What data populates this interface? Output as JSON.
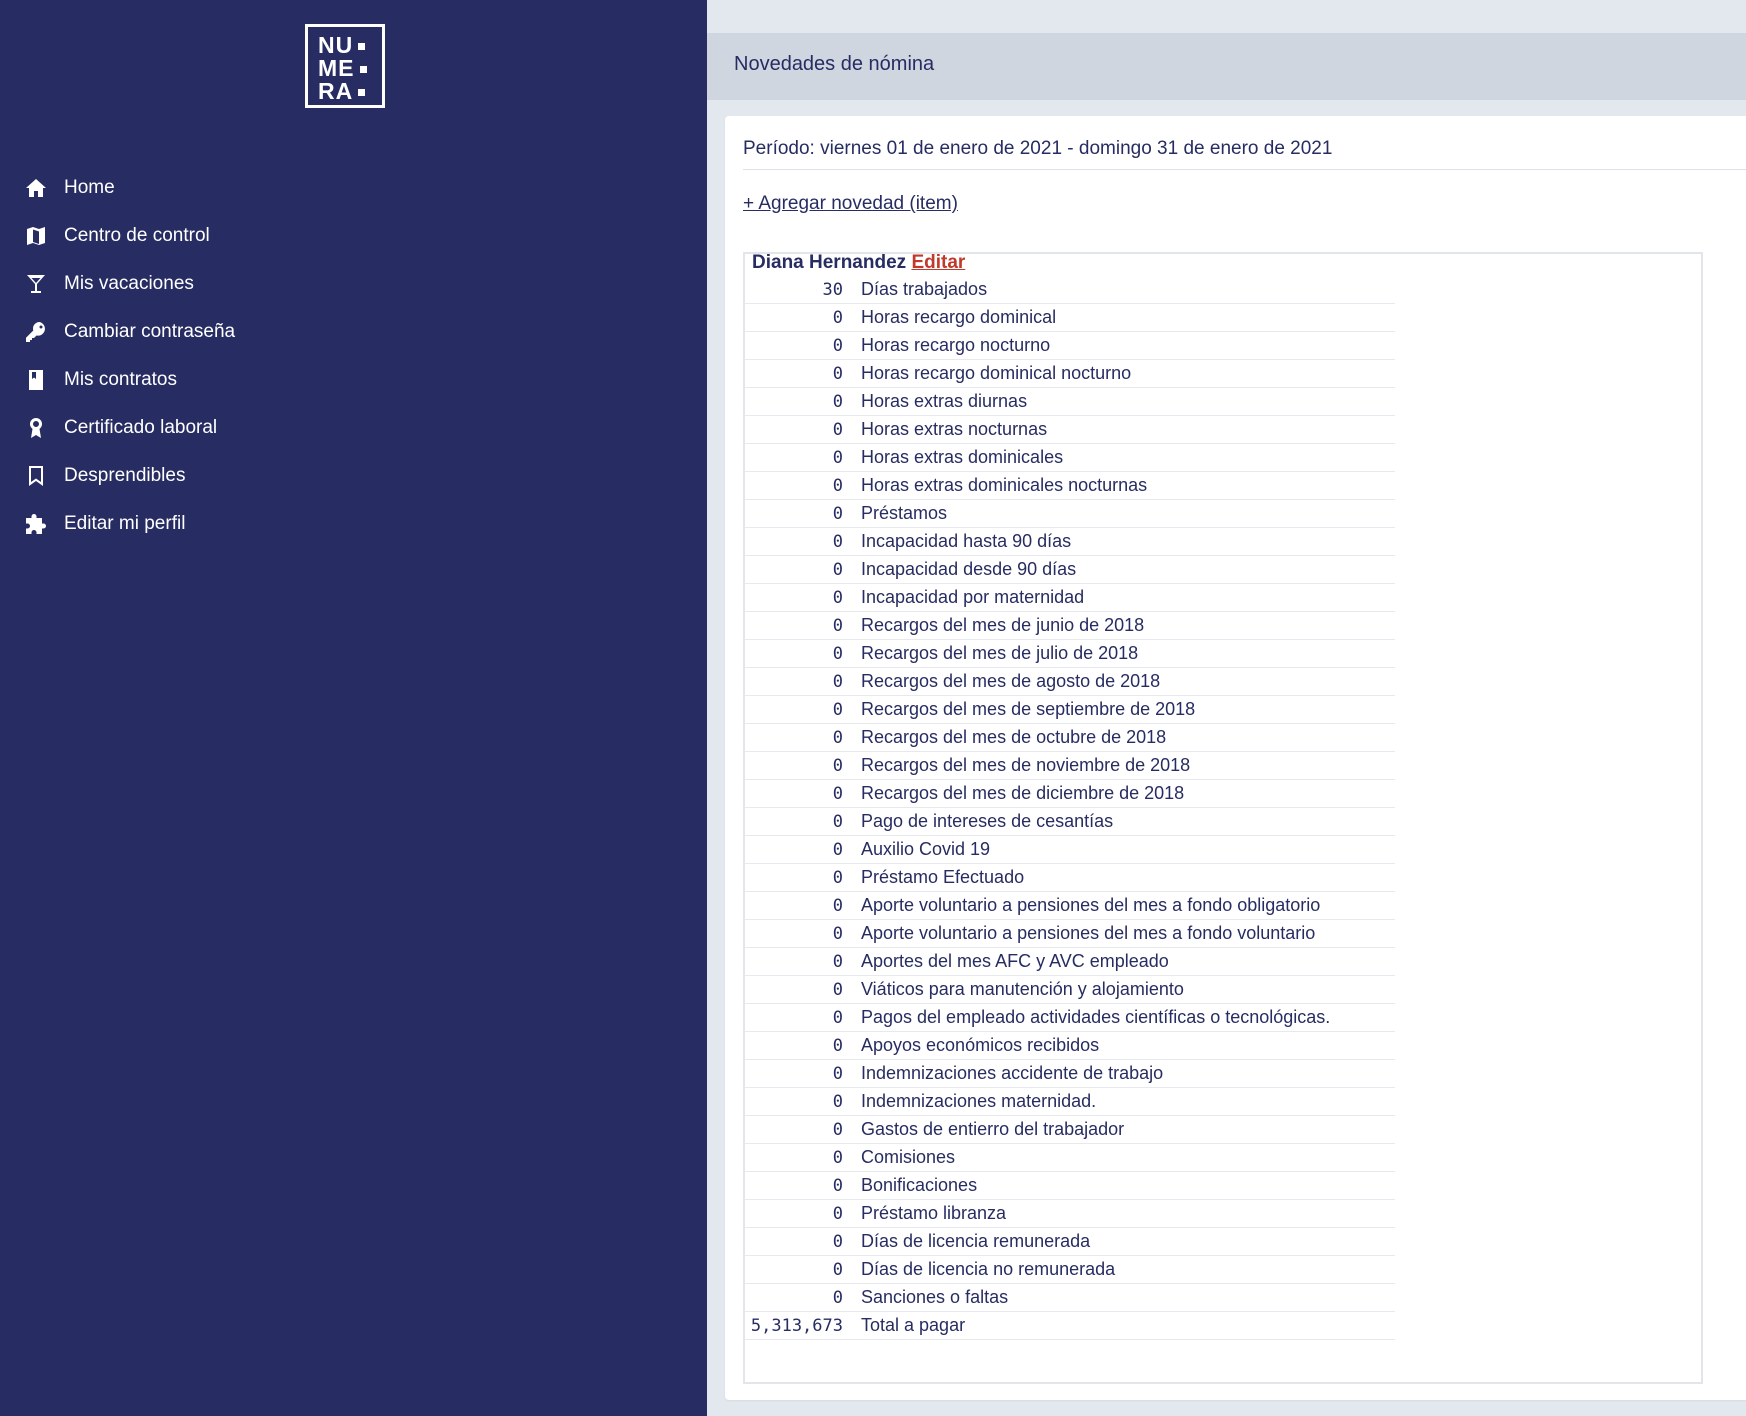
{
  "brand": {
    "logo_lines": [
      "NU",
      "ME",
      "RA"
    ]
  },
  "sidebar": {
    "items": [
      {
        "label": "Home",
        "icon": "home-icon"
      },
      {
        "label": "Centro de control",
        "icon": "map-icon"
      },
      {
        "label": "Mis vacaciones",
        "icon": "cocktail-icon"
      },
      {
        "label": "Cambiar contraseña",
        "icon": "key-icon"
      },
      {
        "label": "Mis contratos",
        "icon": "book-icon"
      },
      {
        "label": "Certificado laboral",
        "icon": "award-icon"
      },
      {
        "label": "Desprendibles",
        "icon": "bookmark-icon"
      },
      {
        "label": "Editar mi perfil",
        "icon": "puzzle-icon"
      }
    ]
  },
  "header": {
    "title": "Novedades de nómina"
  },
  "main": {
    "period": "Período: viernes 01 de enero de 2021 - domingo 31 de enero de 2021",
    "add_link": "+ Agregar novedad (item)",
    "employee": {
      "name": "Diana Hernandez",
      "edit_label": "Editar"
    },
    "rows": [
      {
        "value": "30",
        "label": "Días trabajados"
      },
      {
        "value": "0",
        "label": "Horas recargo dominical"
      },
      {
        "value": "0",
        "label": "Horas recargo nocturno"
      },
      {
        "value": "0",
        "label": "Horas recargo dominical nocturno"
      },
      {
        "value": "0",
        "label": "Horas extras diurnas"
      },
      {
        "value": "0",
        "label": "Horas extras nocturnas"
      },
      {
        "value": "0",
        "label": "Horas extras dominicales"
      },
      {
        "value": "0",
        "label": "Horas extras dominicales nocturnas"
      },
      {
        "value": "0",
        "label": "Préstamos"
      },
      {
        "value": "0",
        "label": "Incapacidad hasta 90 días"
      },
      {
        "value": "0",
        "label": "Incapacidad desde 90 días"
      },
      {
        "value": "0",
        "label": "Incapacidad por maternidad"
      },
      {
        "value": "0",
        "label": "Recargos del mes de junio de 2018"
      },
      {
        "value": "0",
        "label": "Recargos del mes de julio de 2018"
      },
      {
        "value": "0",
        "label": "Recargos del mes de agosto de 2018"
      },
      {
        "value": "0",
        "label": "Recargos del mes de septiembre de 2018"
      },
      {
        "value": "0",
        "label": "Recargos del mes de octubre de 2018"
      },
      {
        "value": "0",
        "label": "Recargos del mes de noviembre de 2018"
      },
      {
        "value": "0",
        "label": "Recargos del mes de diciembre de 2018"
      },
      {
        "value": "0",
        "label": "Pago de intereses de cesantías"
      },
      {
        "value": "0",
        "label": "Auxilio Covid 19"
      },
      {
        "value": "0",
        "label": "Préstamo Efectuado"
      },
      {
        "value": "0",
        "label": "Aporte voluntario a pensiones del mes a fondo obligatorio"
      },
      {
        "value": "0",
        "label": "Aporte voluntario a pensiones del mes a fondo voluntario"
      },
      {
        "value": "0",
        "label": "Aportes del mes AFC y AVC empleado"
      },
      {
        "value": "0",
        "label": "Viáticos para manutención y alojamiento"
      },
      {
        "value": "0",
        "label": "Pagos del empleado actividades científicas o tecnológicas."
      },
      {
        "value": "0",
        "label": "Apoyos económicos recibidos"
      },
      {
        "value": "0",
        "label": "Indemnizaciones accidente de trabajo"
      },
      {
        "value": "0",
        "label": "Indemnizaciones maternidad."
      },
      {
        "value": "0",
        "label": "Gastos de entierro del trabajador"
      },
      {
        "value": "0",
        "label": "Comisiones"
      },
      {
        "value": "0",
        "label": "Bonificaciones"
      },
      {
        "value": "0",
        "label": "Préstamo libranza"
      },
      {
        "value": "0",
        "label": "Días de licencia remunerada"
      },
      {
        "value": "0",
        "label": "Días de licencia no remunerada"
      },
      {
        "value": "0",
        "label": "Sanciones o faltas"
      },
      {
        "value": "5,313,673",
        "label": "Total a pagar"
      }
    ]
  },
  "colors": {
    "sidebar_bg": "#272c62",
    "text_primary": "#272c62",
    "edit_link": "#c0392b",
    "header_bar": "#cfd6e0"
  }
}
